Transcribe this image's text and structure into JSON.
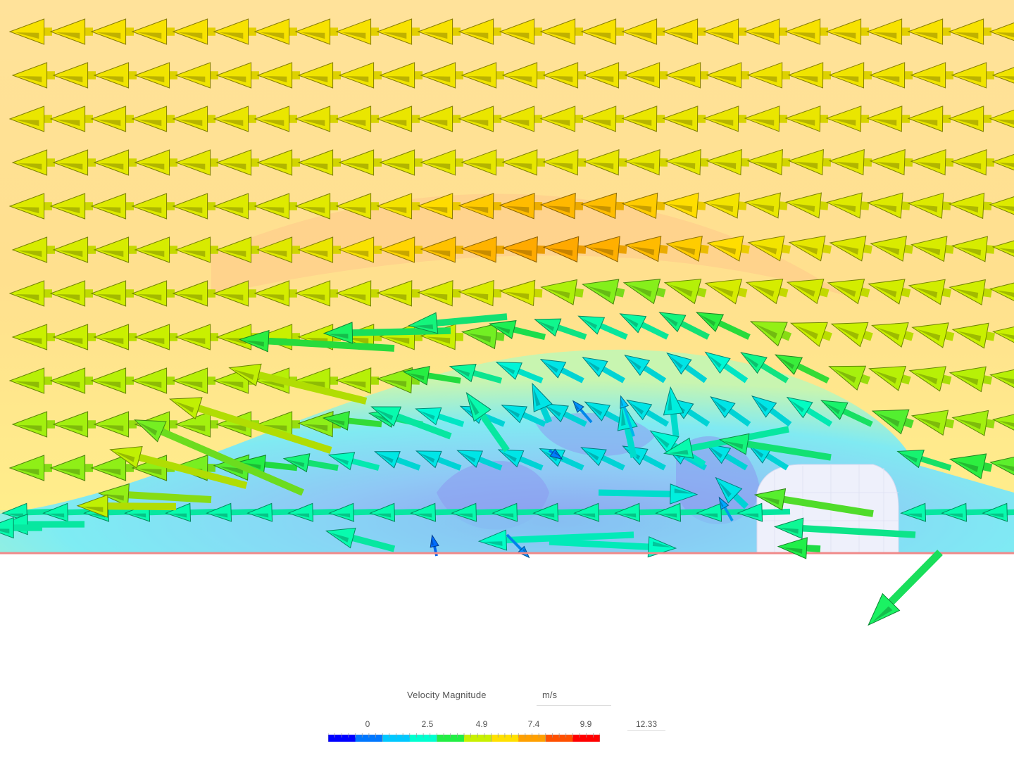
{
  "legend": {
    "title": "Velocity Magnitude",
    "unit": "m/s",
    "ticks": [
      "0",
      "2.5",
      "4.9",
      "7.4",
      "9.9"
    ],
    "max": "12.33",
    "min_value": 0,
    "max_value": 12.33,
    "colormap": [
      "#0000ff",
      "#0077ff",
      "#00c8ff",
      "#00ffd0",
      "#22ee44",
      "#c8f000",
      "#ffe000",
      "#ffa000",
      "#ff5000",
      "#ff0000"
    ]
  },
  "scene": {
    "background_field_color": "#ffe49a",
    "ground_line_color": "#f08a8a",
    "body_color": "#eef0fb",
    "recirculation_color": "#7fe5f0",
    "vortex_core_color": "#8fa0ee"
  }
}
